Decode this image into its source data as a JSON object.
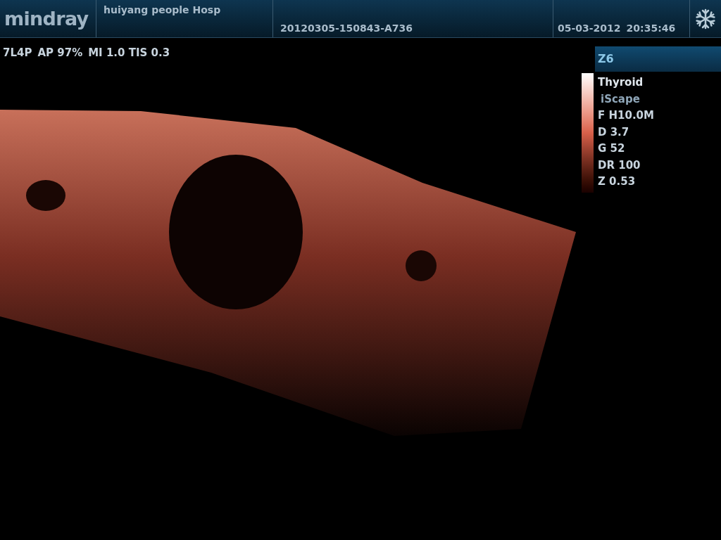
{
  "header": {
    "logo": "mindray",
    "hospital": "huiyang people Hosp",
    "exam_id": "20120305-150843-A736",
    "date": "05-03-2012",
    "time": "20:35:46"
  },
  "probe_info": [
    "7L4P",
    "AP 97%",
    "MI 1.0 TIS 0.3"
  ],
  "side_panel": {
    "title": "Z6",
    "params": [
      {
        "text": "Thyroid",
        "kind": "preset"
      },
      {
        "text": "iScape",
        "kind": "mode"
      },
      {
        "text": "F H10.0M",
        "kind": "value"
      },
      {
        "text": "D 3.7",
        "kind": "value"
      },
      {
        "text": "G 52",
        "kind": "value"
      },
      {
        "text": "DR 100",
        "kind": "value"
      },
      {
        "text": "Z 0.53",
        "kind": "value"
      }
    ]
  }
}
